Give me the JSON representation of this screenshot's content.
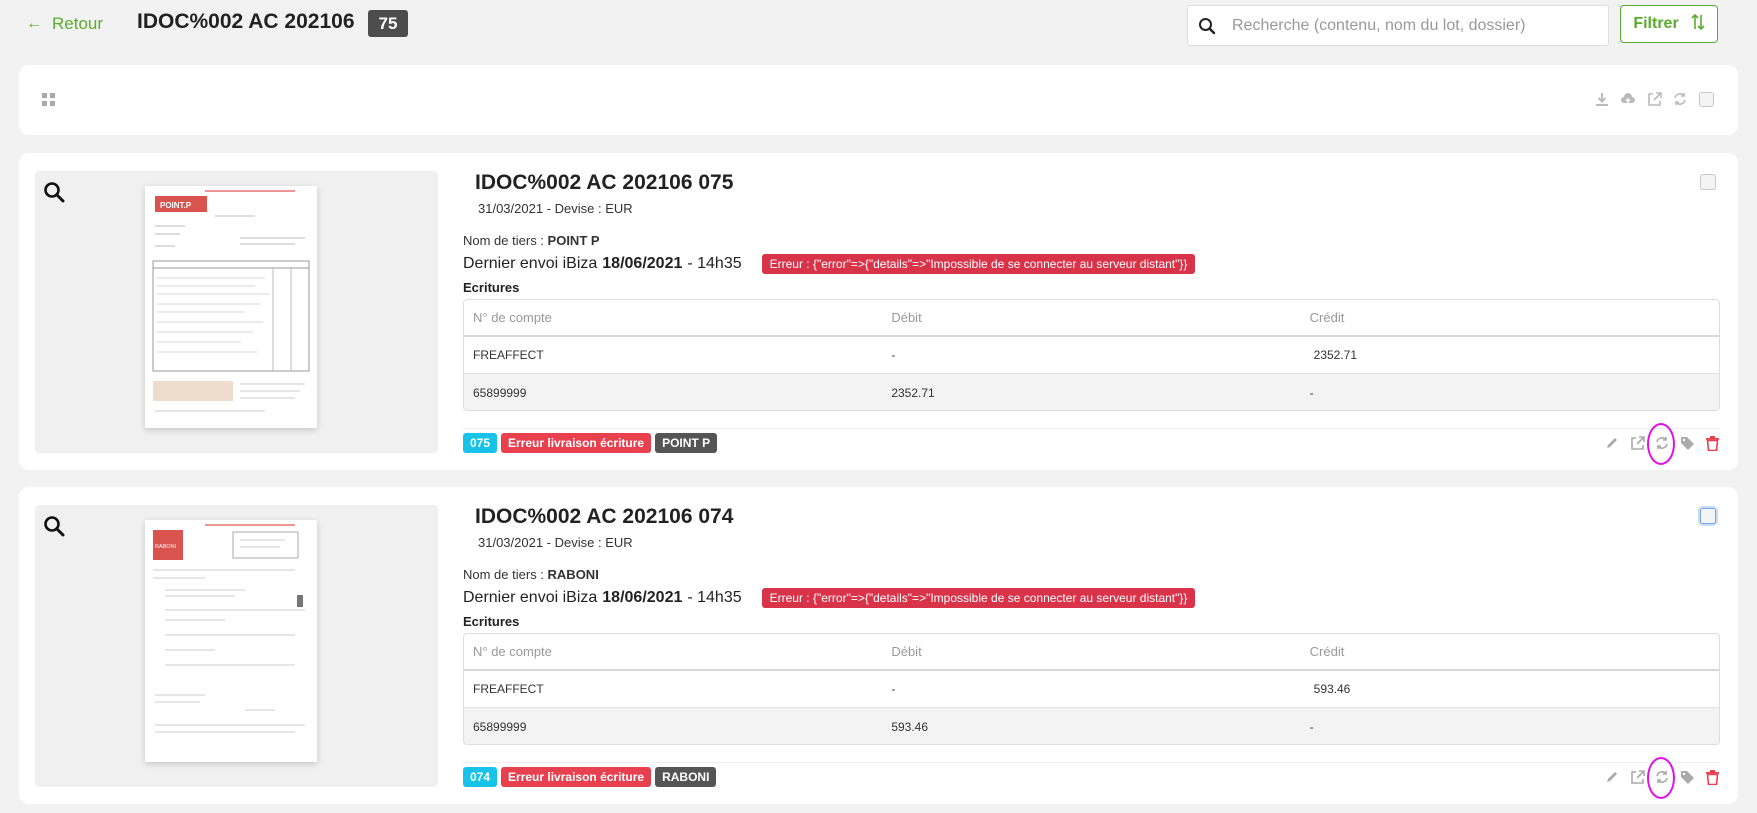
{
  "header": {
    "back_arrow": "←",
    "back_label": "Retour",
    "title": "IDOC%002 AC 202106",
    "count": "75",
    "search_placeholder": "Recherche (contenu, nom du lot, dossier)",
    "filter_label": "Filtrer"
  },
  "table_headers": {
    "account": "N° de compte",
    "debit": "Débit",
    "credit": "Crédit"
  },
  "labels": {
    "tiers_prefix": "Nom de tiers : ",
    "envoi_prefix": "Dernier envoi iBiza",
    "ecritures": "Ecritures"
  },
  "documents": [
    {
      "title": "IDOC%002 AC 202106 075",
      "meta": "31/03/2021 - Devise : EUR",
      "tiers": "POINT P",
      "envoi_date": "18/06/2021",
      "envoi_time": "- 14h35",
      "error": "Erreur : {\"error\"=>{\"details\"=>\"Impossible de se connecter au serveur distant\"}}",
      "rows": [
        {
          "account": "FREAFFECT",
          "debit": "-",
          "credit": "2352.71"
        },
        {
          "account": "65899999",
          "debit": "2352.71",
          "credit": "-"
        }
      ],
      "tag_num": "075",
      "tag_error": "Erreur livraison écriture",
      "tag_name": "POINT P",
      "thumb_brand": "POINT.P"
    },
    {
      "title": "IDOC%002 AC 202106 074",
      "meta": "31/03/2021 - Devise : EUR",
      "tiers": "RABONI",
      "envoi_date": "18/06/2021",
      "envoi_time": "- 14h35",
      "error": "Erreur : {\"error\"=>{\"details\"=>\"Impossible de se connecter au serveur distant\"}}",
      "rows": [
        {
          "account": "FREAFFECT",
          "debit": "-",
          "credit": "593.46"
        },
        {
          "account": "65899999",
          "debit": "593.46",
          "credit": "-"
        }
      ],
      "tag_num": "074",
      "tag_error": "Erreur livraison écriture",
      "tag_name": "RABONI",
      "thumb_brand": "RABONI"
    }
  ],
  "colors": {
    "accent_green": "#5aab2c",
    "error_red": "#d9334a",
    "tag_cyan": "#17c3e8",
    "highlight_ring": "#e010e8"
  }
}
